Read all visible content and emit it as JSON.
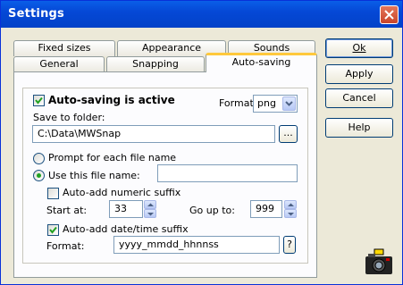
{
  "window": {
    "title": "Settings"
  },
  "tabs": {
    "back": [
      "Fixed sizes",
      "Appearance",
      "Sounds"
    ],
    "front": [
      "General",
      "Snapping",
      "Auto-saving"
    ],
    "active": "Auto-saving"
  },
  "buttons": {
    "ok": "Ok",
    "apply": "Apply",
    "cancel": "Cancel",
    "help": "Help"
  },
  "autosave": {
    "active_label": "Auto-saving is active",
    "active_checked": true,
    "format_label": "Format:",
    "format_value": "png",
    "save_to_label": "Save to folder:",
    "folder_value": "C:\\Data\\MWSnap",
    "browse_label": "...",
    "prompt_label": "Prompt for each file name",
    "use_name_label": "Use this file name:",
    "file_name_value": "",
    "numeric_suffix_label": "Auto-add numeric suffix",
    "numeric_suffix_checked": false,
    "start_at_label": "Start at:",
    "start_at_value": "33",
    "go_up_to_label": "Go up to:",
    "go_up_to_value": "999",
    "datetime_label": "Auto-add date/time suffix",
    "datetime_checked": true,
    "dt_format_label": "Format:",
    "dt_format_value": "yyyy_mmdd_hhnnss",
    "help_q": "?"
  },
  "icons": {
    "app": "camera-icon"
  },
  "colors": {
    "title_bar": "#0548d6",
    "close": "#c9452a",
    "active_tab_accent": "#ffc83c",
    "radio_dot": "#21a121"
  }
}
